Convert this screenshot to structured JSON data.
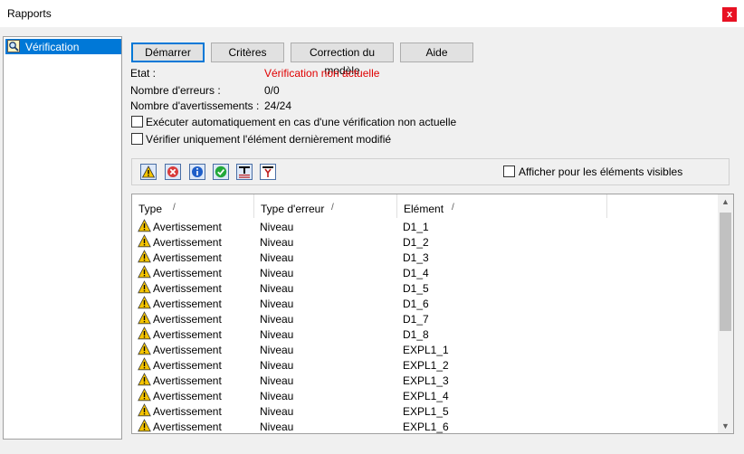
{
  "window": {
    "title": "Rapports",
    "close_label": "x"
  },
  "nav": {
    "items": [
      {
        "label": "Vérification",
        "icon": "magnifier-check-icon"
      }
    ]
  },
  "buttons": {
    "start": "Démarrer",
    "criteria": "Critères",
    "model_correction": "Correction du modèle",
    "help": "Aide"
  },
  "status": {
    "state_label": "Etat :",
    "state_value": "Vérification non actuelle",
    "errors_label": "Nombre d'erreurs :",
    "errors_value": "0/0",
    "warnings_label": "Nombre d'avertissements :",
    "warnings_value": "24/24"
  },
  "options": {
    "auto_run_label": "Exécuter automatiquement en cas d'une vérification non actuelle",
    "auto_run_checked": false,
    "only_last_label": "Vérifier uniquement l'élément dernièrement modifié",
    "only_last_checked": false
  },
  "filter": {
    "visible_only_label": "Afficher pour les éléments visibles",
    "visible_only_checked": false,
    "icons": [
      "warning-filter-icon",
      "error-filter-icon",
      "info-filter-icon",
      "ok-filter-icon",
      "text-filter-icon",
      "beam-filter-icon"
    ]
  },
  "table": {
    "headers": [
      "Type",
      "Type d'erreur",
      "Elément"
    ],
    "sort_marker": "/",
    "rows": [
      {
        "type": "Avertissement",
        "error_type": "Niveau",
        "element": "D1_1"
      },
      {
        "type": "Avertissement",
        "error_type": "Niveau",
        "element": "D1_2"
      },
      {
        "type": "Avertissement",
        "error_type": "Niveau",
        "element": "D1_3"
      },
      {
        "type": "Avertissement",
        "error_type": "Niveau",
        "element": "D1_4"
      },
      {
        "type": "Avertissement",
        "error_type": "Niveau",
        "element": "D1_5"
      },
      {
        "type": "Avertissement",
        "error_type": "Niveau",
        "element": "D1_6"
      },
      {
        "type": "Avertissement",
        "error_type": "Niveau",
        "element": "D1_7"
      },
      {
        "type": "Avertissement",
        "error_type": "Niveau",
        "element": "D1_8"
      },
      {
        "type": "Avertissement",
        "error_type": "Niveau",
        "element": "EXPL1_1"
      },
      {
        "type": "Avertissement",
        "error_type": "Niveau",
        "element": "EXPL1_2"
      },
      {
        "type": "Avertissement",
        "error_type": "Niveau",
        "element": "EXPL1_3"
      },
      {
        "type": "Avertissement",
        "error_type": "Niveau",
        "element": "EXPL1_4"
      },
      {
        "type": "Avertissement",
        "error_type": "Niveau",
        "element": "EXPL1_5"
      },
      {
        "type": "Avertissement",
        "error_type": "Niveau",
        "element": "EXPL1_6"
      }
    ]
  },
  "colors": {
    "accent": "#0078d7",
    "alert": "#e00000",
    "warning": "#f5c400",
    "window_bg": "#f0f0f0"
  }
}
